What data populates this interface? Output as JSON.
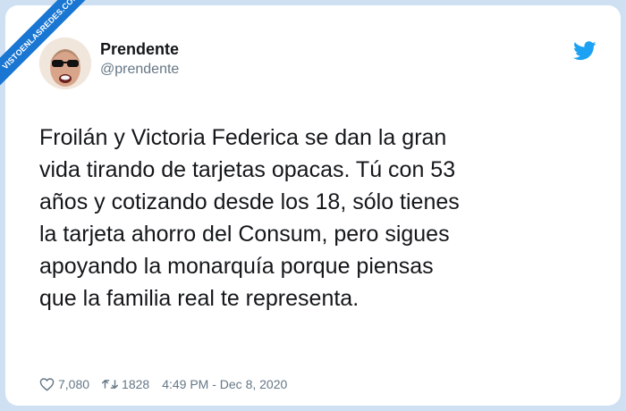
{
  "watermark": {
    "text": "VISTOENLASREDES.COM"
  },
  "tweet": {
    "author": {
      "display_name": "Prendente",
      "handle": "@prendente"
    },
    "text": "Froilán y Victoria Federica se dan la gran\nvida tirando de tarjetas opacas. Tú con 53\naños y cotizando desde los 18, sólo tienes\nla tarjeta ahorro del Consum, pero sigues\napoyando la monarquía porque piensas\nque la familia real te representa.",
    "stats": {
      "likes": "7,080",
      "retweets": "1828"
    },
    "timestamp": "4:49 PM - Dec 8, 2020"
  },
  "colors": {
    "background": "#cfe0f3",
    "card": "#ffffff",
    "ribbon": "#1976d2",
    "twitter_blue": "#1da1f2",
    "text_primary": "#14171a",
    "text_secondary": "#657786"
  },
  "icons": {
    "brand": "twitter-bird-icon",
    "likes": "heart-icon",
    "retweets": "retweet-icon"
  }
}
